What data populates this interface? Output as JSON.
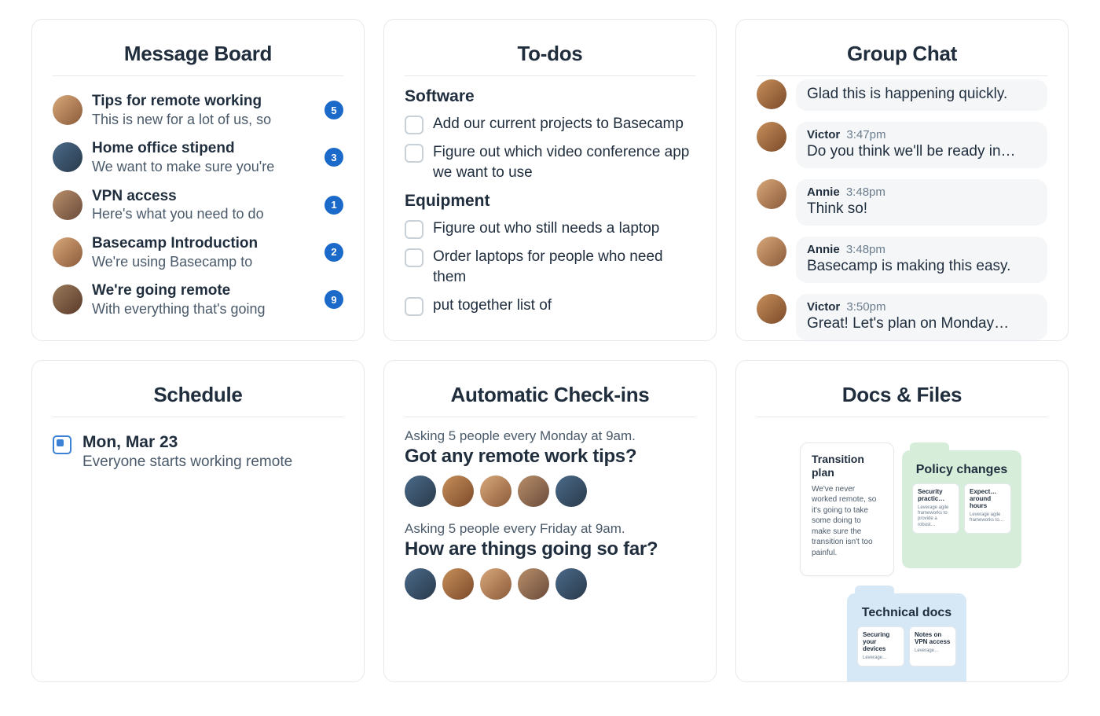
{
  "cards": {
    "message_board": {
      "title": "Message Board",
      "items": [
        {
          "title": "Tips for remote working",
          "preview": "This is new for a lot of us, so",
          "count": 5,
          "avatar": "v2"
        },
        {
          "title": "Home office stipend",
          "preview": "We want to make sure you're",
          "count": 3,
          "avatar": "v3"
        },
        {
          "title": "VPN access",
          "preview": "Here's what you need to do",
          "count": 1,
          "avatar": "v4"
        },
        {
          "title": "Basecamp Introduction",
          "preview": "We're using Basecamp to",
          "count": 2,
          "avatar": "v2"
        },
        {
          "title": "We're going remote",
          "preview": "With everything that's going",
          "count": 9,
          "avatar": "v5"
        }
      ]
    },
    "todos": {
      "title": "To-dos",
      "groups": [
        {
          "name": "Software",
          "items": [
            "Add our current projects to Basecamp",
            "Figure out which video conference app we want to use"
          ]
        },
        {
          "name": "Equipment",
          "items": [
            "Figure out who still needs a laptop",
            "Order laptops for people who need them",
            "put together list of"
          ]
        }
      ]
    },
    "group_chat": {
      "title": "Group Chat",
      "messages": [
        {
          "author": "",
          "time": "",
          "body": "Glad this is happening quickly.",
          "avatar": "v1",
          "show_meta": false
        },
        {
          "author": "Victor",
          "time": "3:47pm",
          "body": "Do you think we'll be ready in…",
          "avatar": "v1",
          "show_meta": true
        },
        {
          "author": "Annie",
          "time": "3:48pm",
          "body": "Think so!",
          "avatar": "v2",
          "show_meta": true
        },
        {
          "author": "Annie",
          "time": "3:48pm",
          "body": "Basecamp is making this easy.",
          "avatar": "v2",
          "show_meta": true
        },
        {
          "author": "Victor",
          "time": "3:50pm",
          "body": "Great! Let's plan on Monday…",
          "avatar": "v1",
          "show_meta": true
        }
      ]
    },
    "schedule": {
      "title": "Schedule",
      "events": [
        {
          "date": "Mon, Mar 23",
          "text": "Everyone starts working remote"
        }
      ]
    },
    "checkins": {
      "title": "Automatic Check-ins",
      "items": [
        {
          "sub": "Asking 5 people every Monday at 9am.",
          "question": "Got any remote work tips?",
          "avatars": [
            "v3",
            "v1",
            "v2",
            "v4",
            "v3"
          ]
        },
        {
          "sub": "Asking 5 people every Friday at 9am.",
          "question": "How are things going so far?",
          "avatars": [
            "v3",
            "v1",
            "v2",
            "v4",
            "v3"
          ]
        }
      ]
    },
    "docs": {
      "title": "Docs & Files",
      "doc1": {
        "title": "Transition plan",
        "body": "We've never worked remote, so it's going to take some doing to make sure the transition isn't too painful."
      },
      "folder_green": {
        "title": "Policy changes",
        "mini": [
          {
            "t": "Security practic…",
            "b": "Leverage agile frameworks to provide a robust…"
          },
          {
            "t": "Expect… around hours",
            "b": "Leverage agile frameworks to…"
          }
        ]
      },
      "folder_blue": {
        "title": "Technical docs",
        "mini": [
          {
            "t": "Securing your devices",
            "b": "Leverage…"
          },
          {
            "t": "Notes on VPN access",
            "b": "Leverage…"
          }
        ]
      }
    }
  }
}
